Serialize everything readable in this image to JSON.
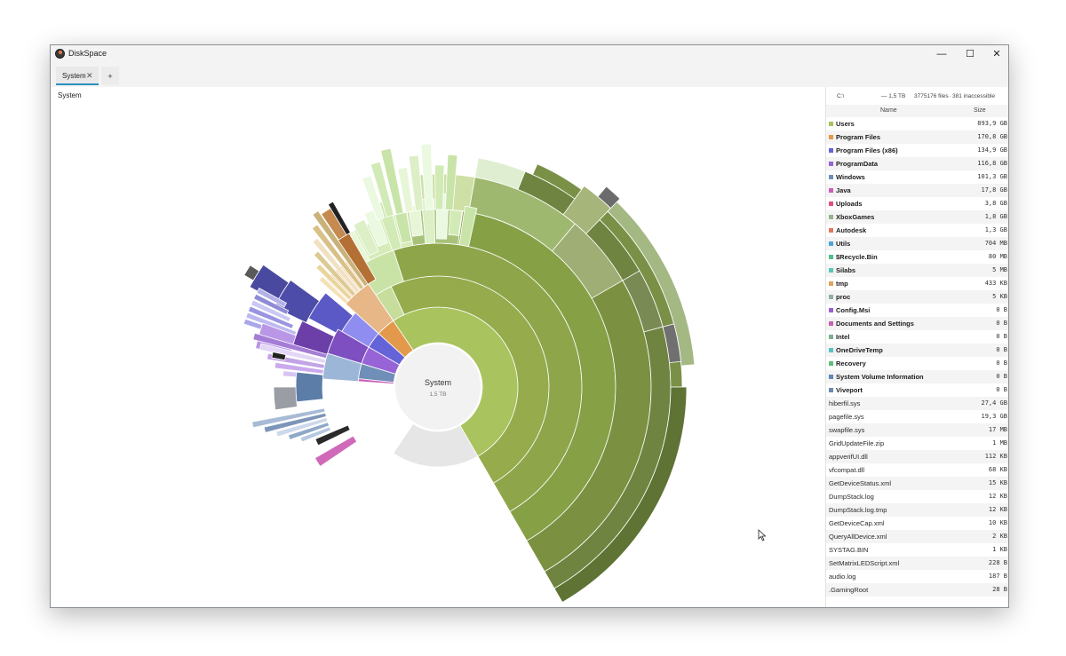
{
  "window": {
    "title": "DiskSpace",
    "controls": {
      "minimize": "—",
      "maximize": "☐",
      "close": "✕"
    }
  },
  "tabs": [
    {
      "label": "System",
      "close": "✕"
    }
  ],
  "tab_add": "+",
  "breadcrumb": "System",
  "center": {
    "title": "System",
    "size": "1,5 TB"
  },
  "summary": {
    "path": "C:\\",
    "size": "— 1,5 TB",
    "files": "3775176 files",
    "inaccessible": "· 381 inaccessible"
  },
  "columns": {
    "name": "Name",
    "size": "Size"
  },
  "folders": [
    {
      "name": "Users",
      "size": "893,9 GB",
      "color": "#a9c35e"
    },
    {
      "name": "Program Files",
      "size": "170,8 GB",
      "color": "#e3994c"
    },
    {
      "name": "Program Files (x86)",
      "size": "134,9 GB",
      "color": "#6463d8"
    },
    {
      "name": "ProgramData",
      "size": "116,8 GB",
      "color": "#9763d6"
    },
    {
      "name": "Windows",
      "size": "101,3 GB",
      "color": "#6f8eb8"
    },
    {
      "name": "Java",
      "size": "17,8 GB",
      "color": "#c85fb8"
    },
    {
      "name": "Uploads",
      "size": "3,8 GB",
      "color": "#e0507c"
    },
    {
      "name": "XboxGames",
      "size": "1,8 GB",
      "color": "#93b48c"
    },
    {
      "name": "Autodesk",
      "size": "1,3 GB",
      "color": "#e3765f"
    },
    {
      "name": "Utils",
      "size": "704 MB",
      "color": "#4aa6d8"
    },
    {
      "name": "$Recycle.Bin",
      "size": "80 MB",
      "color": "#4fbf8a"
    },
    {
      "name": "Silabs",
      "size": "5 MB",
      "color": "#5bc3b8"
    },
    {
      "name": "tmp",
      "size": "433 KB",
      "color": "#e0a55a"
    },
    {
      "name": "proc",
      "size": "5 KB",
      "color": "#8fb0a0"
    },
    {
      "name": "Config.Msi",
      "size": "0 B",
      "color": "#9a5fd0"
    },
    {
      "name": "Documents and Settings",
      "size": "0 B",
      "color": "#c860b0"
    },
    {
      "name": "Intel",
      "size": "0 B",
      "color": "#7fae90"
    },
    {
      "name": "OneDriveTemp",
      "size": "0 B",
      "color": "#5cc0c0"
    },
    {
      "name": "Recovery",
      "size": "0 B",
      "color": "#5dbf7a"
    },
    {
      "name": "System Volume Information",
      "size": "0 B",
      "color": "#5f86b8"
    },
    {
      "name": "Viveport",
      "size": "0 B",
      "color": "#6a88b0"
    }
  ],
  "files": [
    {
      "name": "hiberfil.sys",
      "size": "27,4 GB"
    },
    {
      "name": "pagefile.sys",
      "size": "19,3 GB"
    },
    {
      "name": "swapfile.sys",
      "size": "17 MB"
    },
    {
      "name": "GridUpdateFile.zip",
      "size": "1 MB"
    },
    {
      "name": "appverifUI.dll",
      "size": "112 KB"
    },
    {
      "name": "vfcompat.dll",
      "size": "68 KB"
    },
    {
      "name": "GetDeviceStatus.xml",
      "size": "15 KB"
    },
    {
      "name": "DumpStack.log",
      "size": "12 KB"
    },
    {
      "name": "DumpStack.log.tmp",
      "size": "12 KB"
    },
    {
      "name": "GetDeviceCap.xml",
      "size": "10 KB"
    },
    {
      "name": "QueryAllDevice.xml",
      "size": "2 KB"
    },
    {
      "name": "SYSTAG.BIN",
      "size": "1 KB"
    },
    {
      "name": "SetMatrixLEDScript.xml",
      "size": "228 B"
    },
    {
      "name": "audio.log",
      "size": "187 B"
    },
    {
      ".GamingRoot": "",
      "name": ".GamingRoot",
      "size": "28 B"
    }
  ]
}
